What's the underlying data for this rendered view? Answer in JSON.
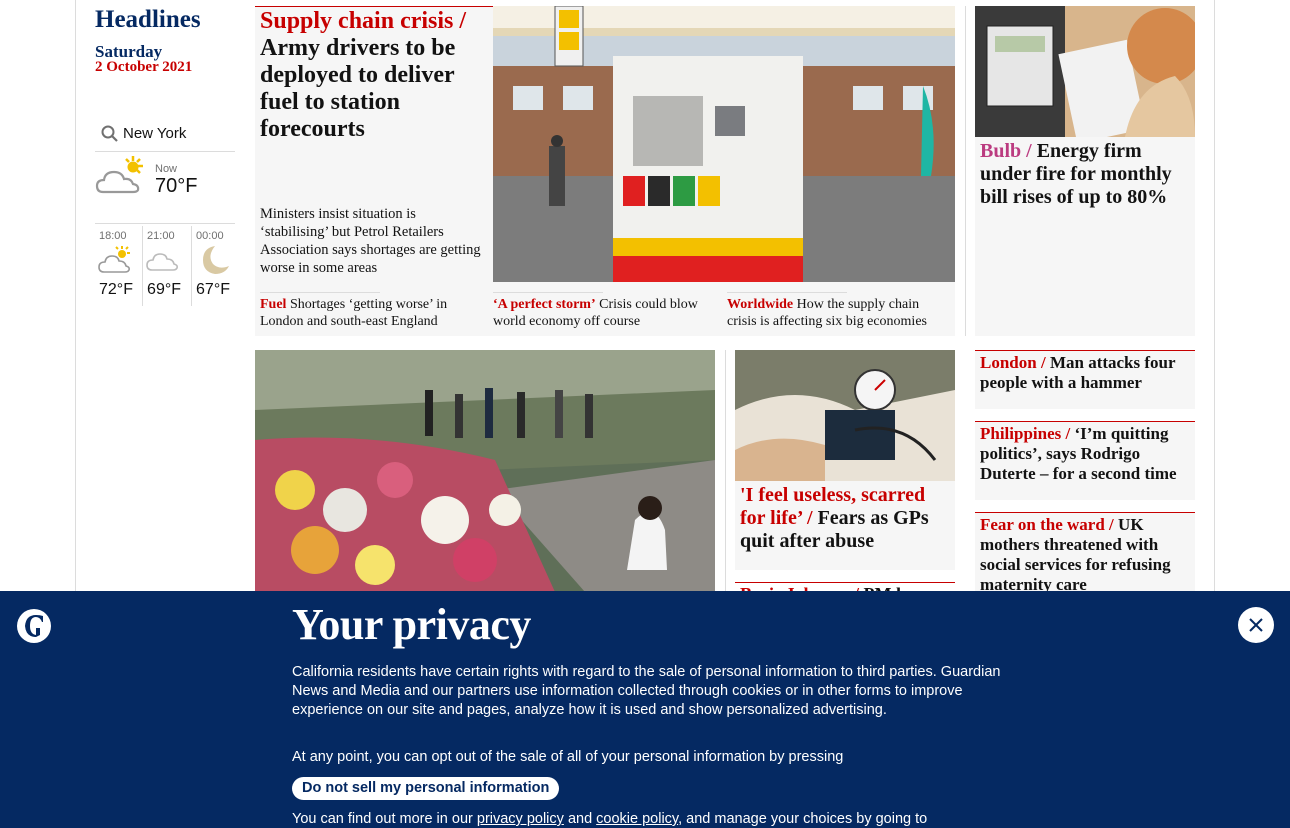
{
  "sidebar": {
    "title": "Headlines",
    "day": "Saturday",
    "date": "2 October 2021"
  },
  "weather": {
    "location": "New York",
    "now_label": "Now",
    "now_temp": "70°F",
    "now_icon": "partly-cloudy-sun-icon",
    "forecast": [
      {
        "time": "18:00",
        "temp": "72°F",
        "icon": "partly-cloudy-sun-icon"
      },
      {
        "time": "21:00",
        "temp": "69°F",
        "icon": "cloud-icon"
      },
      {
        "time": "00:00",
        "temp": "67°F",
        "icon": "moon-icon"
      }
    ]
  },
  "lead": {
    "kicker": "Supply chain crisis /",
    "headline": "Army drivers to be deployed to deliver fuel to station forecourts",
    "standfirst": "Ministers insist situation is ‘stabilising’ but Petrol Retailers Association says shortages are getting worse in some areas",
    "sublinks": [
      {
        "kicker": "Fuel",
        "headline": "Shortages ‘getting worse’ in London and south-east England"
      },
      {
        "kicker": "‘A perfect storm’",
        "headline": "Crisis could blow world economy off course"
      },
      {
        "kicker": "Worldwide",
        "headline": "How the supply chain crisis is affecting six big economies"
      }
    ]
  },
  "right_top": {
    "kicker": "Bulb /",
    "headline": "Energy firm under fire for monthly bill rises of up to 80%"
  },
  "gp_story": {
    "kicker": "'I feel useless, scarred for life’ /",
    "headline": "Fears as GPs quit after abuse"
  },
  "bj_story": {
    "kicker": "Boris Johnson /",
    "headline": "PM has"
  },
  "right_cards": [
    {
      "kicker": "London /",
      "headline": "Man attacks four people with a hammer"
    },
    {
      "kicker": "Philippines /",
      "headline": "‘I’m quitting politics’, says Rodrigo Duterte – for a second time"
    },
    {
      "kicker": "Fear on the ward /",
      "headline": "UK mothers threatened with social services for refusing maternity care"
    }
  ],
  "banner": {
    "title": "Your privacy",
    "text1": "California residents have certain rights with regard to the sale of personal information to third parties. Guardian News and Media and our partners use information collected through cookies or in other forms to improve experience on our site and pages, analyze how it is used and show personalized advertising.",
    "text2": "At any point, you can opt out of the sale of all of your personal information by pressing",
    "button": "Do not sell my personal information",
    "text3_a": "You can find out more in our",
    "link_privacy": "privacy policy",
    "text3_b": "and",
    "link_cookie": "cookie policy",
    "text3_c": ", and manage your choices by going to"
  },
  "colors": {
    "brand_blue": "#052962",
    "news_red": "#c70000",
    "opinion_pink": "#c74600",
    "lifestyle_pink": "#bb3b80"
  }
}
